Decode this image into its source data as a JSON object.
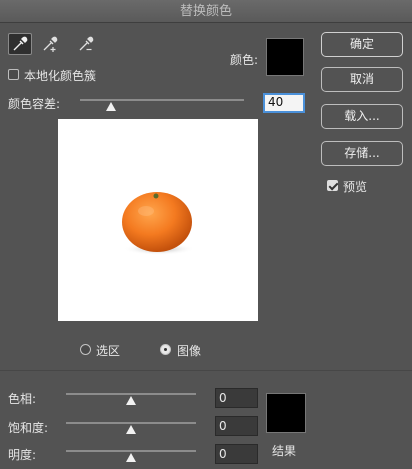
{
  "window": {
    "title": "替换颜色"
  },
  "tools": [
    "eyedropper-icon",
    "eyedropper-plus-icon",
    "eyedropper-minus-icon"
  ],
  "localized_clusters": {
    "label": "本地化颜色簇",
    "checked": false
  },
  "selection_color": {
    "label": "颜色:",
    "color": "#000000"
  },
  "fuzziness": {
    "label": "颜色容差:",
    "value": "40",
    "level": 0.2
  },
  "view_mode": {
    "selection_label": "选区",
    "image_label": "图像",
    "selected": "image"
  },
  "buttons": {
    "ok": "确定",
    "cancel": "取消",
    "load": "载入...",
    "save": "存储..."
  },
  "preview_toggle": {
    "label": "预览",
    "checked": true
  },
  "replacement": {
    "hue": {
      "label": "色相:",
      "value": "0",
      "level": 0.5
    },
    "saturation": {
      "label": "饱和度:",
      "value": "0",
      "level": 0.5
    },
    "lightness": {
      "label": "明度:",
      "value": "0",
      "level": 0.5
    },
    "result_label": "结果",
    "result_color": "#000000"
  },
  "colors": {
    "background": "#535353",
    "accent": "#4a90d9"
  }
}
